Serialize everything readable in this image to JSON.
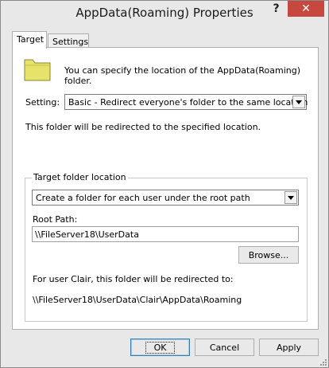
{
  "window": {
    "title": "AppData(Roaming) Properties",
    "help_icon": "?",
    "close_icon": "✕"
  },
  "tabs": [
    {
      "label": "Target",
      "active": true
    },
    {
      "label": "Settings",
      "active": false
    }
  ],
  "target_tab": {
    "intro": "You can specify the location of the AppData(Roaming) folder.",
    "setting_label": "Setting:",
    "setting_value": "Basic - Redirect everyone's folder to the same location",
    "redirect_note": "This folder will be redirected to the specified location.",
    "group_label": "Target folder location",
    "target_value": "Create a folder for each user under the root path",
    "root_path_label": "Root Path:",
    "root_path_value": "\\\\FileServer18\\UserData",
    "browse_label": "Browse...",
    "redirect_user_label": "For user Clair, this folder will be redirected to:",
    "redirect_user_path": "\\\\FileServer18\\UserData\\Clair\\AppData\\Roaming"
  },
  "buttons": {
    "ok": "OK",
    "cancel": "Cancel",
    "apply": "Apply"
  },
  "colors": {
    "close_button": "#c7483f",
    "folder": "#e6e26a"
  }
}
